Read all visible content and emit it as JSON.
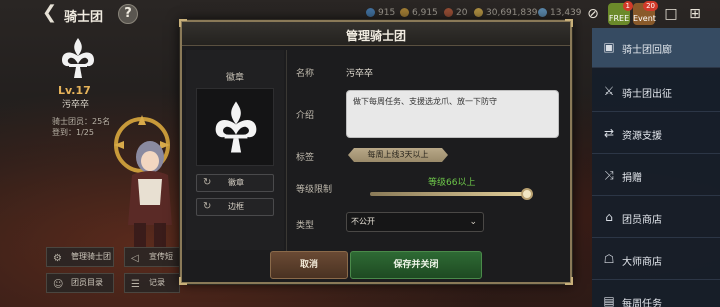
{
  "topbar": {
    "title": "骑士团",
    "help": "?",
    "resources": [
      "915",
      "6,915",
      "20",
      "30,691,839",
      "13,439"
    ],
    "gift_label": "FREE",
    "gift_badge": "1",
    "event_label": "Event",
    "event_badge": "20"
  },
  "left_panel": {
    "level": "Lv.17",
    "name": "污卒卒",
    "members": "骑士团员：25名",
    "ranking": "登到：1/25",
    "buttons": {
      "manage": "管理骑士团",
      "war": "宣传短",
      "member_list": "团员目录",
      "record": "记录"
    }
  },
  "sidebar": {
    "items": [
      {
        "label": "骑士团回廊",
        "icon": "gallery-icon"
      },
      {
        "label": "骑士团出征",
        "icon": "crossed-swords-icon"
      },
      {
        "label": "资源支援",
        "icon": "support-icon"
      },
      {
        "label": "捐赠",
        "icon": "shuffle-icon"
      },
      {
        "label": "团员商店",
        "icon": "shop-icon"
      },
      {
        "label": "大师商店",
        "icon": "master-shop-icon"
      },
      {
        "label": "每周任务",
        "icon": "weekly-task-icon"
      }
    ],
    "active_index": 0
  },
  "modal": {
    "title": "管理骑士团",
    "emblem_label": "徽章",
    "emblem_button": "徽章",
    "frame_button": "边框",
    "fields": {
      "name_label": "名称",
      "name_value": "污卒卒",
      "intro_label": "介绍",
      "intro_value": "做下每周任务、支援选龙爪、放一下防守",
      "tag_label": "标签",
      "tag_value": "每周上线3天以上",
      "level_label": "等级限制",
      "level_value": "等级66以上",
      "level_fraction": 0.98,
      "type_label": "类型",
      "type_value": "不公开"
    },
    "cancel_label": "取消",
    "save_label": "保存并关闭"
  },
  "colors": {
    "accent_gold": "#8a7a58",
    "level_green": "#6ec84a",
    "save_green": "#2e6a34",
    "cancel_brown": "#6a4a34",
    "sidebar_active": "#3a5068"
  }
}
